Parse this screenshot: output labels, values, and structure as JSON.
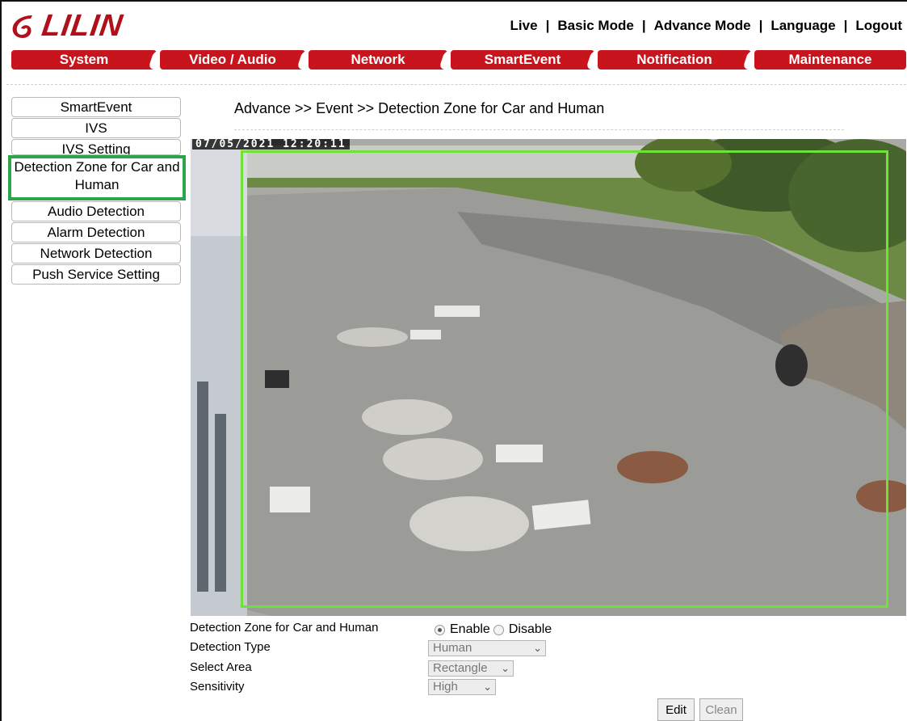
{
  "brand": {
    "logo_text": "LILIN",
    "color": "#b0101a"
  },
  "top_links": [
    "Live",
    "Basic Mode",
    "Advance Mode",
    "Language",
    "Logout"
  ],
  "top_separator": "|",
  "nav_tabs": [
    "System",
    "Video / Audio",
    "Network",
    "SmartEvent",
    "Notification",
    "Maintenance"
  ],
  "nav_color": "#c8141c",
  "side_menu": [
    {
      "label": "SmartEvent",
      "active": false
    },
    {
      "label": "IVS",
      "active": false
    },
    {
      "label": "IVS Setting",
      "active": false
    },
    {
      "label": "Detection Zone for Car and Human",
      "active": true
    },
    {
      "label": "Audio Detection",
      "active": false
    },
    {
      "label": "Alarm Detection",
      "active": false
    },
    {
      "label": "Network Detection",
      "active": false
    },
    {
      "label": "Push Service Setting",
      "active": false
    }
  ],
  "active_highlight_color": "#2ea44a",
  "breadcrumb": "Advance >> Event >> Detection Zone for Car and Human",
  "video": {
    "timestamp": "07/05/2021  12:20:11",
    "zone_color": "#6fe23a"
  },
  "form": {
    "zone_label": "Detection Zone for Car and Human",
    "enable_label": "Enable",
    "disable_label": "Disable",
    "enabled": true,
    "type_label": "Detection Type",
    "type_value": "Human",
    "area_label": "Select Area",
    "area_value": "Rectangle",
    "sensitivity_label": "Sensitivity",
    "sensitivity_value": "High",
    "edit_label": "Edit",
    "clean_label": "Clean"
  }
}
